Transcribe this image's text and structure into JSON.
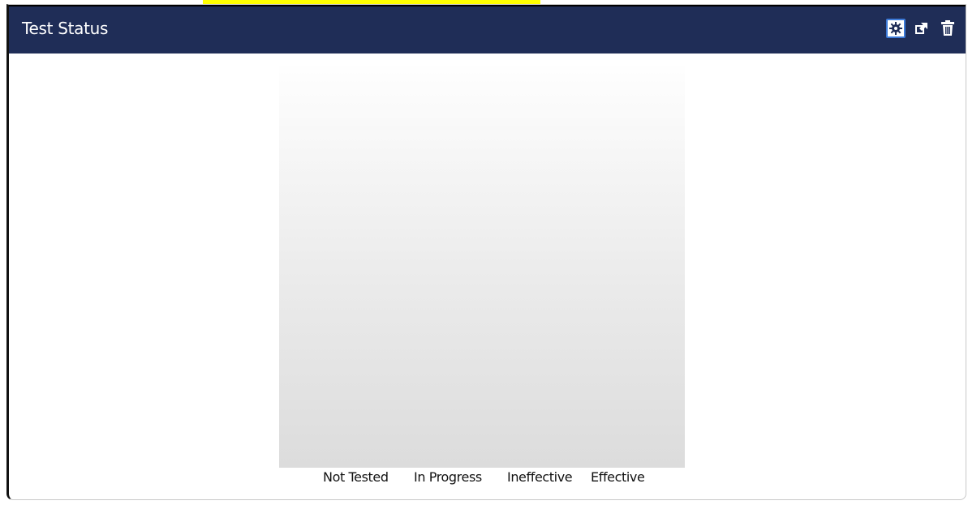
{
  "widget": {
    "title": "Test Status",
    "icons": [
      {
        "name": "settings-icon",
        "color": "#1f2d57"
      },
      {
        "name": "popout-icon",
        "color": "#ffffff"
      },
      {
        "name": "trash-icon",
        "color": "#ffffff"
      }
    ]
  },
  "chart_data": {
    "type": "bar",
    "title": "",
    "xlabel": "",
    "ylabel": "",
    "categories": [
      "Not Tested",
      "In Progress",
      "Ineffective",
      "Effective"
    ],
    "values": [],
    "grid": false,
    "background": "gradient #fefefe to #dcdcdc"
  },
  "colors": {
    "header_bg": "#1f2d57",
    "header_text": "#ffffff",
    "highlight": "#ffff00",
    "settings_border": "#3d7bd9"
  }
}
